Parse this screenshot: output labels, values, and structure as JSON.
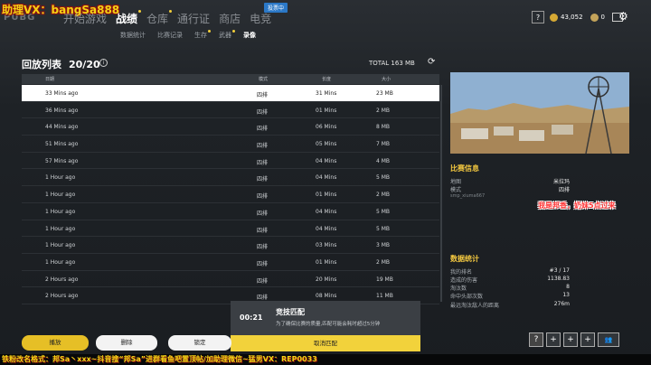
{
  "watermark_top": "助理VX：bangSa888",
  "logo": "PUBG",
  "nav": {
    "items": [
      {
        "label": "开始游戏",
        "active": false,
        "dot": false
      },
      {
        "label": "战绩",
        "active": true,
        "dot": true
      },
      {
        "label": "仓库",
        "active": false,
        "dot": true
      },
      {
        "label": "通行证",
        "active": false,
        "dot": false
      },
      {
        "label": "商店",
        "active": false,
        "dot": false
      },
      {
        "label": "电竞",
        "active": false,
        "dot": false
      }
    ],
    "esports_badge": "投票中"
  },
  "subnav": {
    "items": [
      {
        "label": "数据统计",
        "active": false,
        "dot": false
      },
      {
        "label": "比赛记录",
        "active": false,
        "dot": false
      },
      {
        "label": "生存",
        "active": false,
        "dot": true
      },
      {
        "label": "武器",
        "active": false,
        "dot": true
      },
      {
        "label": "录像",
        "active": true,
        "dot": false
      }
    ]
  },
  "top_right": {
    "help": "?",
    "coins": "43,052",
    "gcoin": "0"
  },
  "replay": {
    "title": "回放列表",
    "count": "20/20",
    "total": "TOTAL 163 MB",
    "columns": [
      "日期",
      "模式",
      "长度",
      "大小"
    ],
    "rows": [
      {
        "date": "33 Mins ago",
        "mode": "四排",
        "length": "31 Mins",
        "size": "23 MB",
        "selected": true
      },
      {
        "date": "36 Mins ago",
        "mode": "四排",
        "length": "01 Mins",
        "size": "2 MB",
        "selected": false
      },
      {
        "date": "44 Mins ago",
        "mode": "四排",
        "length": "06 Mins",
        "size": "8 MB",
        "selected": false
      },
      {
        "date": "51 Mins ago",
        "mode": "四排",
        "length": "05 Mins",
        "size": "7 MB",
        "selected": false
      },
      {
        "date": "57 Mins ago",
        "mode": "四排",
        "length": "04 Mins",
        "size": "4 MB",
        "selected": false
      },
      {
        "date": "1 Hour ago",
        "mode": "四排",
        "length": "04 Mins",
        "size": "5 MB",
        "selected": false
      },
      {
        "date": "1 Hour ago",
        "mode": "四排",
        "length": "01 Mins",
        "size": "2 MB",
        "selected": false
      },
      {
        "date": "1 Hour ago",
        "mode": "四排",
        "length": "04 Mins",
        "size": "5 MB",
        "selected": false
      },
      {
        "date": "1 Hour ago",
        "mode": "四排",
        "length": "04 Mins",
        "size": "5 MB",
        "selected": false
      },
      {
        "date": "1 Hour ago",
        "mode": "四排",
        "length": "03 Mins",
        "size": "3 MB",
        "selected": false
      },
      {
        "date": "1 Hour ago",
        "mode": "四排",
        "length": "01 Mins",
        "size": "2 MB",
        "selected": false
      },
      {
        "date": "2 Hours ago",
        "mode": "四排",
        "length": "20 Mins",
        "size": "19 MB",
        "selected": false
      },
      {
        "date": "2 Hours ago",
        "mode": "四排",
        "length": "08 Mins",
        "size": "11 MB",
        "selected": false
      }
    ]
  },
  "match_info": {
    "title": "比赛信息",
    "map_label": "地图",
    "map_value": "米拉玛",
    "mode_label": "模式",
    "mode_value": "四排",
    "map_tag": "smp_xiuma667"
  },
  "red_caption": "我是邦香，奶妹5点过来",
  "stats": {
    "title": "数据统计",
    "items": [
      {
        "label": "我的排名",
        "value": "#3 / 17"
      },
      {
        "label": "造成的伤害",
        "value": "1138.83"
      },
      {
        "label": "淘汰数",
        "value": "8"
      },
      {
        "label": "命中头部次数",
        "value": "13"
      },
      {
        "label": "最远淘汰敌人的距离",
        "value": "276m"
      }
    ]
  },
  "matchmaking": {
    "time": "00:21",
    "title": "竞技匹配",
    "desc": "为了确保比赛的质量,匹配可能会耗时超过5分钟",
    "cancel": "取消匹配"
  },
  "buttons": {
    "play": "播放",
    "delete": "删除",
    "lock": "锁定"
  },
  "squad": {
    "help": "?",
    "plus": "+"
  },
  "ticker": "铁粉改名格式：邦Sa丶xxx~抖音搜“邦Sa”进群看鱼吧置顶帖/加助理微信~猛男VX：REP0033"
}
